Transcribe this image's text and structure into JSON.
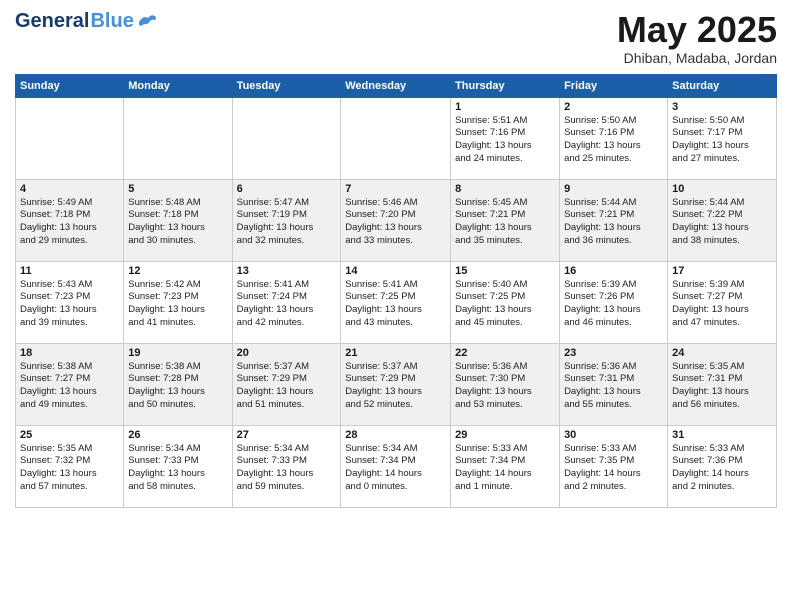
{
  "header": {
    "logo_general": "General",
    "logo_blue": "Blue",
    "month": "May 2025",
    "location": "Dhiban, Madaba, Jordan"
  },
  "days_of_week": [
    "Sunday",
    "Monday",
    "Tuesday",
    "Wednesday",
    "Thursday",
    "Friday",
    "Saturday"
  ],
  "weeks": [
    [
      {
        "day": "",
        "info": ""
      },
      {
        "day": "",
        "info": ""
      },
      {
        "day": "",
        "info": ""
      },
      {
        "day": "",
        "info": ""
      },
      {
        "day": "1",
        "info": "Sunrise: 5:51 AM\nSunset: 7:16 PM\nDaylight: 13 hours\nand 24 minutes."
      },
      {
        "day": "2",
        "info": "Sunrise: 5:50 AM\nSunset: 7:16 PM\nDaylight: 13 hours\nand 25 minutes."
      },
      {
        "day": "3",
        "info": "Sunrise: 5:50 AM\nSunset: 7:17 PM\nDaylight: 13 hours\nand 27 minutes."
      }
    ],
    [
      {
        "day": "4",
        "info": "Sunrise: 5:49 AM\nSunset: 7:18 PM\nDaylight: 13 hours\nand 29 minutes."
      },
      {
        "day": "5",
        "info": "Sunrise: 5:48 AM\nSunset: 7:18 PM\nDaylight: 13 hours\nand 30 minutes."
      },
      {
        "day": "6",
        "info": "Sunrise: 5:47 AM\nSunset: 7:19 PM\nDaylight: 13 hours\nand 32 minutes."
      },
      {
        "day": "7",
        "info": "Sunrise: 5:46 AM\nSunset: 7:20 PM\nDaylight: 13 hours\nand 33 minutes."
      },
      {
        "day": "8",
        "info": "Sunrise: 5:45 AM\nSunset: 7:21 PM\nDaylight: 13 hours\nand 35 minutes."
      },
      {
        "day": "9",
        "info": "Sunrise: 5:44 AM\nSunset: 7:21 PM\nDaylight: 13 hours\nand 36 minutes."
      },
      {
        "day": "10",
        "info": "Sunrise: 5:44 AM\nSunset: 7:22 PM\nDaylight: 13 hours\nand 38 minutes."
      }
    ],
    [
      {
        "day": "11",
        "info": "Sunrise: 5:43 AM\nSunset: 7:23 PM\nDaylight: 13 hours\nand 39 minutes."
      },
      {
        "day": "12",
        "info": "Sunrise: 5:42 AM\nSunset: 7:23 PM\nDaylight: 13 hours\nand 41 minutes."
      },
      {
        "day": "13",
        "info": "Sunrise: 5:41 AM\nSunset: 7:24 PM\nDaylight: 13 hours\nand 42 minutes."
      },
      {
        "day": "14",
        "info": "Sunrise: 5:41 AM\nSunset: 7:25 PM\nDaylight: 13 hours\nand 43 minutes."
      },
      {
        "day": "15",
        "info": "Sunrise: 5:40 AM\nSunset: 7:25 PM\nDaylight: 13 hours\nand 45 minutes."
      },
      {
        "day": "16",
        "info": "Sunrise: 5:39 AM\nSunset: 7:26 PM\nDaylight: 13 hours\nand 46 minutes."
      },
      {
        "day": "17",
        "info": "Sunrise: 5:39 AM\nSunset: 7:27 PM\nDaylight: 13 hours\nand 47 minutes."
      }
    ],
    [
      {
        "day": "18",
        "info": "Sunrise: 5:38 AM\nSunset: 7:27 PM\nDaylight: 13 hours\nand 49 minutes."
      },
      {
        "day": "19",
        "info": "Sunrise: 5:38 AM\nSunset: 7:28 PM\nDaylight: 13 hours\nand 50 minutes."
      },
      {
        "day": "20",
        "info": "Sunrise: 5:37 AM\nSunset: 7:29 PM\nDaylight: 13 hours\nand 51 minutes."
      },
      {
        "day": "21",
        "info": "Sunrise: 5:37 AM\nSunset: 7:29 PM\nDaylight: 13 hours\nand 52 minutes."
      },
      {
        "day": "22",
        "info": "Sunrise: 5:36 AM\nSunset: 7:30 PM\nDaylight: 13 hours\nand 53 minutes."
      },
      {
        "day": "23",
        "info": "Sunrise: 5:36 AM\nSunset: 7:31 PM\nDaylight: 13 hours\nand 55 minutes."
      },
      {
        "day": "24",
        "info": "Sunrise: 5:35 AM\nSunset: 7:31 PM\nDaylight: 13 hours\nand 56 minutes."
      }
    ],
    [
      {
        "day": "25",
        "info": "Sunrise: 5:35 AM\nSunset: 7:32 PM\nDaylight: 13 hours\nand 57 minutes."
      },
      {
        "day": "26",
        "info": "Sunrise: 5:34 AM\nSunset: 7:33 PM\nDaylight: 13 hours\nand 58 minutes."
      },
      {
        "day": "27",
        "info": "Sunrise: 5:34 AM\nSunset: 7:33 PM\nDaylight: 13 hours\nand 59 minutes."
      },
      {
        "day": "28",
        "info": "Sunrise: 5:34 AM\nSunset: 7:34 PM\nDaylight: 14 hours\nand 0 minutes."
      },
      {
        "day": "29",
        "info": "Sunrise: 5:33 AM\nSunset: 7:34 PM\nDaylight: 14 hours\nand 1 minute."
      },
      {
        "day": "30",
        "info": "Sunrise: 5:33 AM\nSunset: 7:35 PM\nDaylight: 14 hours\nand 2 minutes."
      },
      {
        "day": "31",
        "info": "Sunrise: 5:33 AM\nSunset: 7:36 PM\nDaylight: 14 hours\nand 2 minutes."
      }
    ]
  ]
}
